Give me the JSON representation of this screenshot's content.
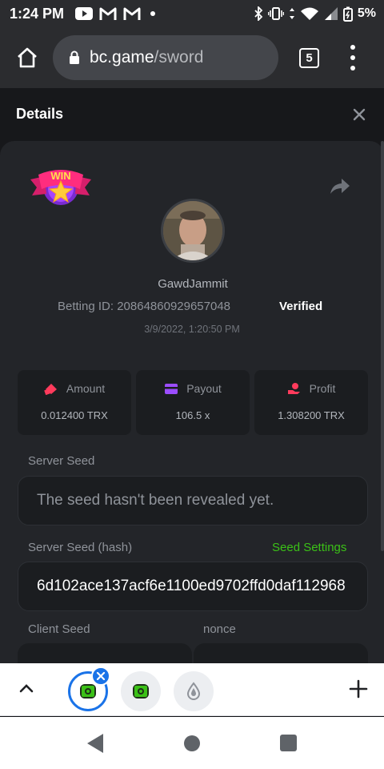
{
  "status_bar": {
    "time": "1:24 PM",
    "battery": "5%",
    "left_icons": [
      "youtube-icon",
      "gmail-icon",
      "gmail-icon",
      "dot-icon"
    ],
    "right_icons": [
      "bluetooth-icon",
      "vibrate-icon",
      "data-icon",
      "wifi-icon",
      "signal-icon",
      "battery-icon"
    ]
  },
  "browser": {
    "url_host": "bc.game",
    "url_path": "/sword",
    "tab_count": "5"
  },
  "details": {
    "title": "Details",
    "username": "GawdJammit",
    "betting_id": "Betting ID: 20864860929657048",
    "verified": "Verified",
    "date": "3/9/2022, 1:20:50 PM",
    "badge_text": "WIN"
  },
  "stats": [
    {
      "label": "Amount",
      "value": "0.012400 TRX",
      "icon": "amount-icon"
    },
    {
      "label": "Payout",
      "value": "106.5 x",
      "icon": "wallet-icon"
    },
    {
      "label": "Profit",
      "value": "1.308200 TRX",
      "icon": "profit-icon"
    }
  ],
  "fields": {
    "server_seed_label": "Server Seed",
    "server_seed_value": "The seed hasn't been revealed yet.",
    "server_hash_label": "Server Seed (hash)",
    "seed_settings": "Seed Settings",
    "server_hash_value": "6d102ace137acf6e1100ed9702ffd0daf112968",
    "client_seed_label": "Client Seed",
    "nonce_label": "nonce"
  },
  "colors": {
    "accent_green": "#3bc117",
    "chrome_blue": "#1a73e8",
    "card_bg": "#232529"
  }
}
